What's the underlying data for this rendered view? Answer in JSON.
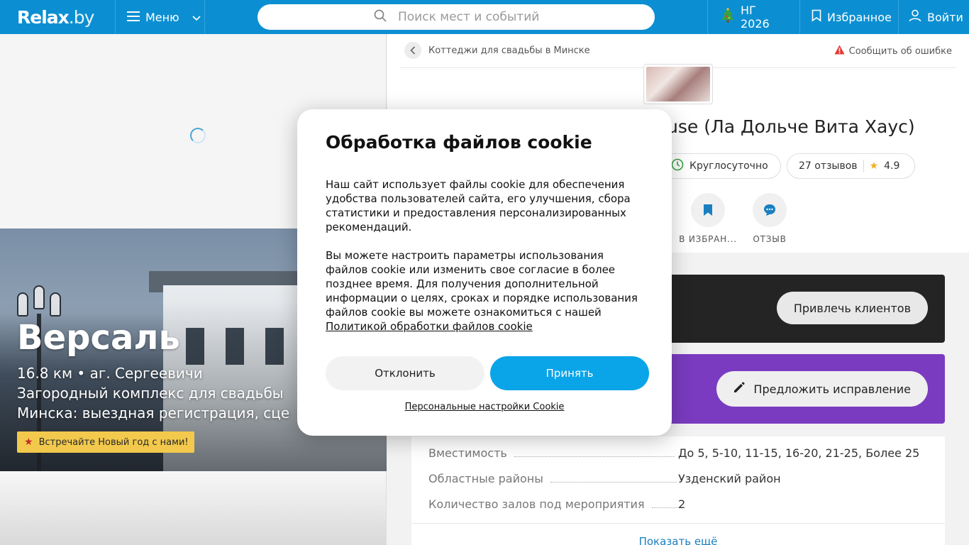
{
  "header": {
    "logo": "Relax",
    "logo_suffix": ".by",
    "menu_label": "Меню",
    "search_placeholder": "Поиск мест и событий",
    "ng_label": "НГ 2026",
    "favorites_label": "Избранное",
    "login_label": "Войти"
  },
  "hero": {
    "title": "Версаль",
    "line1": "16.8 км • аг. Сергеевичи",
    "line2": "Загородный комплекс для свадьбы",
    "line3": "Минска: выездная регистрация, сце",
    "promo": "Встречайте Новый год с нами!"
  },
  "venue": {
    "breadcrumb": "Коттеджи для свадьбы в Минске",
    "report": "Сообщить об ошибке",
    "title": "use (Ла Дольче Вита Хаус)",
    "hours": "Круглосуточно",
    "reviews": "27 отзывов",
    "rating": "4.9",
    "action_fav": "В ИЗБРАН...",
    "action_review": "ОТЗЫВ"
  },
  "cards": {
    "attract": "Привлечь клиентов",
    "suggest": "Предложить исправление"
  },
  "props": [
    {
      "key": "Вместимость",
      "value": "До 5, 5-10, 11-15, 16-20, 21-25, Более 25"
    },
    {
      "key": "Областные районы",
      "value": "Узденский район"
    },
    {
      "key": "Количество залов под мероприятия",
      "value": "2"
    }
  ],
  "show_more": "Показать ещё",
  "cookie": {
    "title": "Обработка файлов cookie",
    "p1": "Наш сайт использует файлы cookie для обеспечения удобства пользователей сайта, его улучшения, сбора статистики и предоставления персонализированных рекомендаций.",
    "p2": "Вы можете настроить параметры использования файлов cookie или изменить свое согласие в более позднее время. Для получения дополнительной информации о целях, сроках и порядке использования файлов cookie вы можете ознакомиться с нашей",
    "policy_link": "Политикой обработки файлов cookie",
    "decline": "Отклонить",
    "accept": "Принять",
    "settings": "Персональные настройки Cookie"
  },
  "colors": {
    "header_bg": "#0c8fd2",
    "accept_bg": "#0aa4e8",
    "edit_card_bg": "#7a3bc0",
    "promo_bg": "#f2c94c"
  }
}
